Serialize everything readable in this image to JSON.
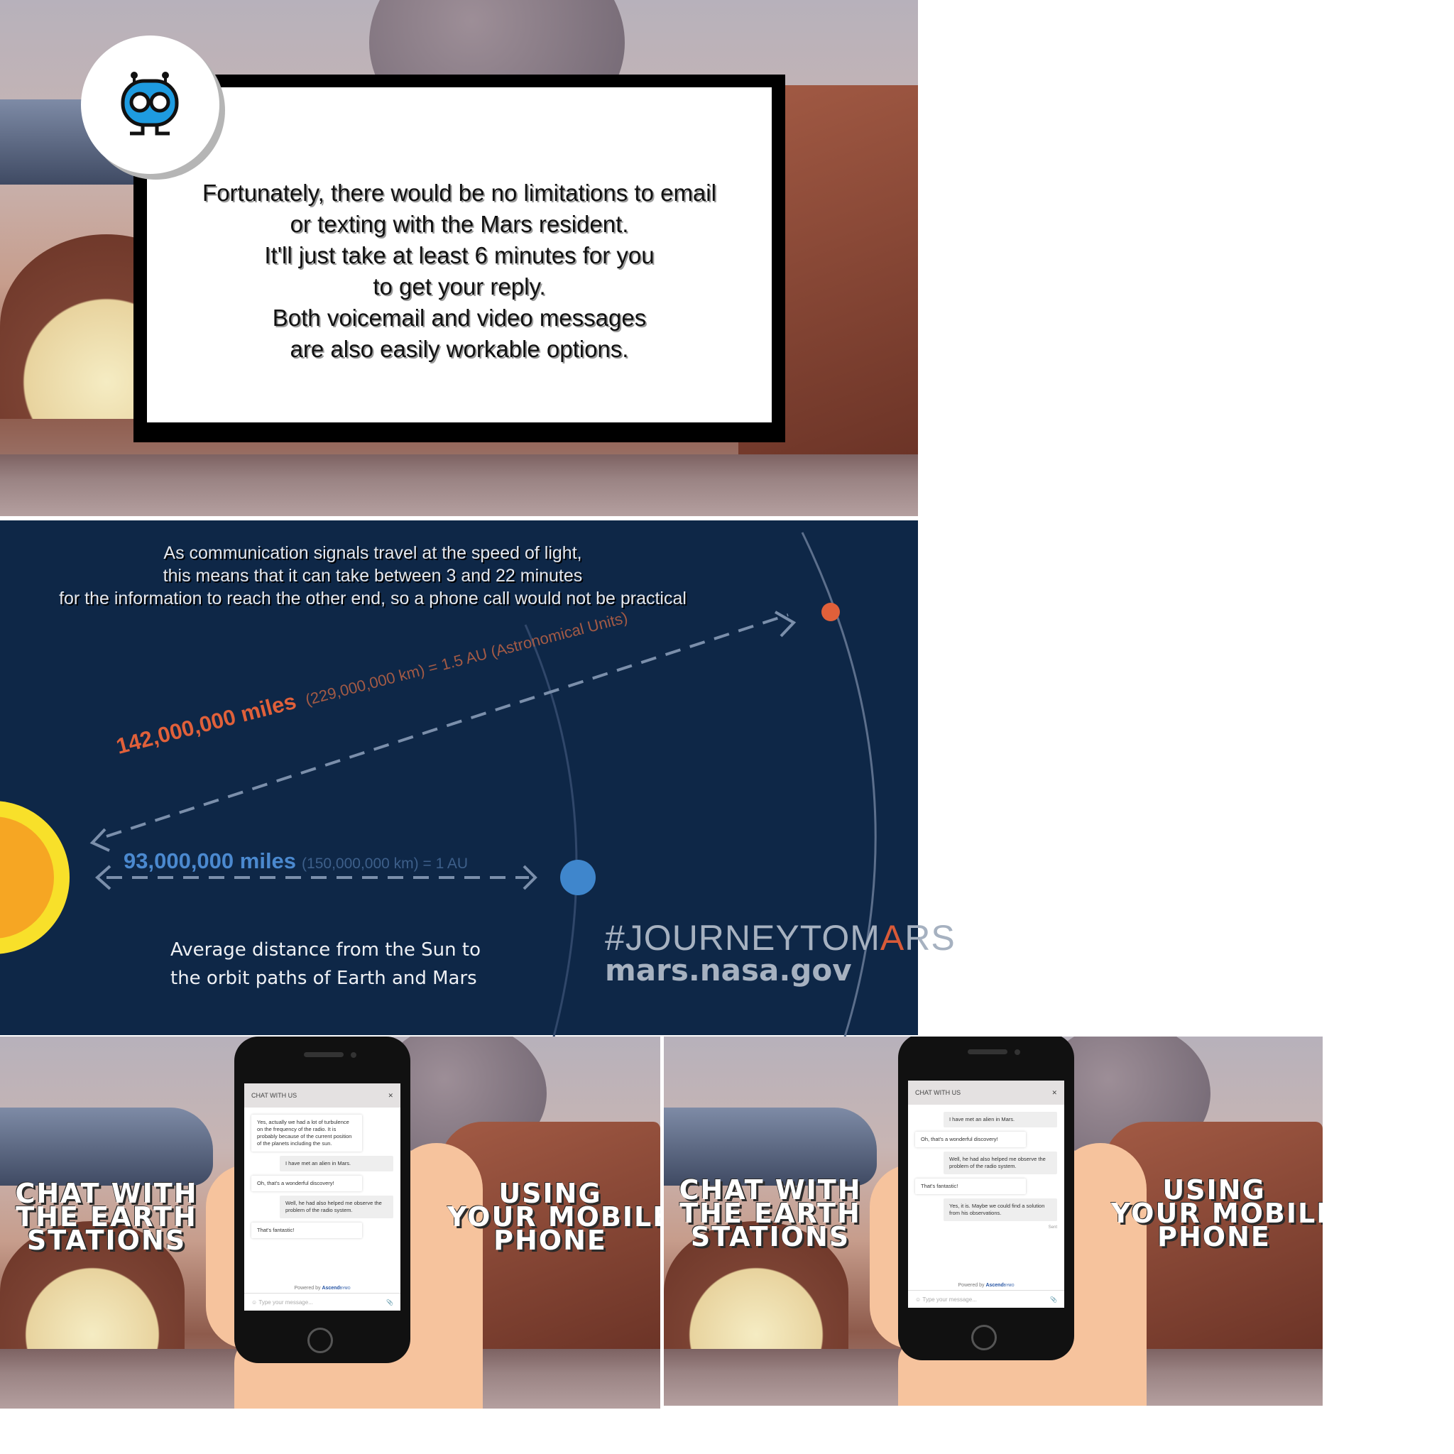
{
  "panel_top": {
    "dialog_lines": [
      "Fortunately, there would be no limitations to email",
      "or texting with the Mars resident.",
      "It'll just take at least 6 minutes for you",
      "to get your reply.",
      "Both voicemail and video messages",
      "are also easily workable options."
    ],
    "avatar_icon": "alien-mascot-icon",
    "colors": {
      "frame": "#000000",
      "mascot": "#1e9be0"
    }
  },
  "panel_mid": {
    "caption_lines": [
      "As communication signals travel at the speed of light,",
      "this means that it can take between 3 and 22 minutes",
      "for the information to reach the other end, so a phone call would not be practical"
    ],
    "mars_distance": {
      "miles": "142,000,000 miles",
      "detail": "(229,000,000 km) = 1.5 AU (Astronomical Units)"
    },
    "earth_distance": {
      "miles": "93,000,000 miles",
      "detail": "(150,000,000 km) = 1 AU"
    },
    "average_lines": [
      "Average distance from the Sun to",
      "the orbit paths of Earth and Mars"
    ],
    "hashtag_prefix": "#JOURNEYTOM",
    "hashtag_highlight": "A",
    "hashtag_suffix": "RS",
    "url": "mars.nasa.gov",
    "colors": {
      "background": "#0e2747",
      "mars": "#e0603a",
      "earth": "#3f86cc",
      "sun": "#f6a623"
    }
  },
  "panel_bottom_left": {
    "left_headline": [
      "CHAT WITH",
      "THE EARTH",
      "STATIONS"
    ],
    "right_headline": [
      "USING",
      "YOUR MOBILE",
      "PHONE"
    ],
    "chat_title": "CHAT WITH US",
    "close": "✕",
    "messages": [
      {
        "dir": "in",
        "text": "Yes, actually we had a lot of turbulence on the frequency of the radio. It is probably because of the current position of the planets including the sun."
      },
      {
        "dir": "out",
        "text": "I have met an alien in Mars."
      },
      {
        "dir": "in",
        "text": "Oh, that's a wonderful discovery!"
      },
      {
        "dir": "out",
        "text": "Well, he had also helped me observe the problem of the radio system."
      },
      {
        "dir": "in",
        "text": "That's fantastic!"
      }
    ],
    "powered_by": "Powered by",
    "brand": "Ascend",
    "brand_suffix": "BYMO",
    "input_placeholder": "Type your message..."
  },
  "panel_bottom_right": {
    "left_headline": [
      "CHAT WITH",
      "THE EARTH",
      "STATIONS"
    ],
    "right_headline": [
      "USING",
      "YOUR MOBILE",
      "PHONE"
    ],
    "chat_title": "CHAT WITH US",
    "close": "✕",
    "messages": [
      {
        "dir": "out",
        "text": "I have met an alien in Mars."
      },
      {
        "dir": "in",
        "text": "Oh, that's a wonderful discovery!"
      },
      {
        "dir": "out",
        "text": "Well, he had also helped me observe the problem of the radio system."
      },
      {
        "dir": "in",
        "text": "That's fantastic!"
      },
      {
        "dir": "out",
        "text": "Yes, it is. Maybe we could find a solution from his observations."
      }
    ],
    "sent_label": "Sent",
    "powered_by": "Powered by",
    "brand": "Ascend",
    "brand_suffix": "BYMO",
    "input_placeholder": "Type your message..."
  }
}
